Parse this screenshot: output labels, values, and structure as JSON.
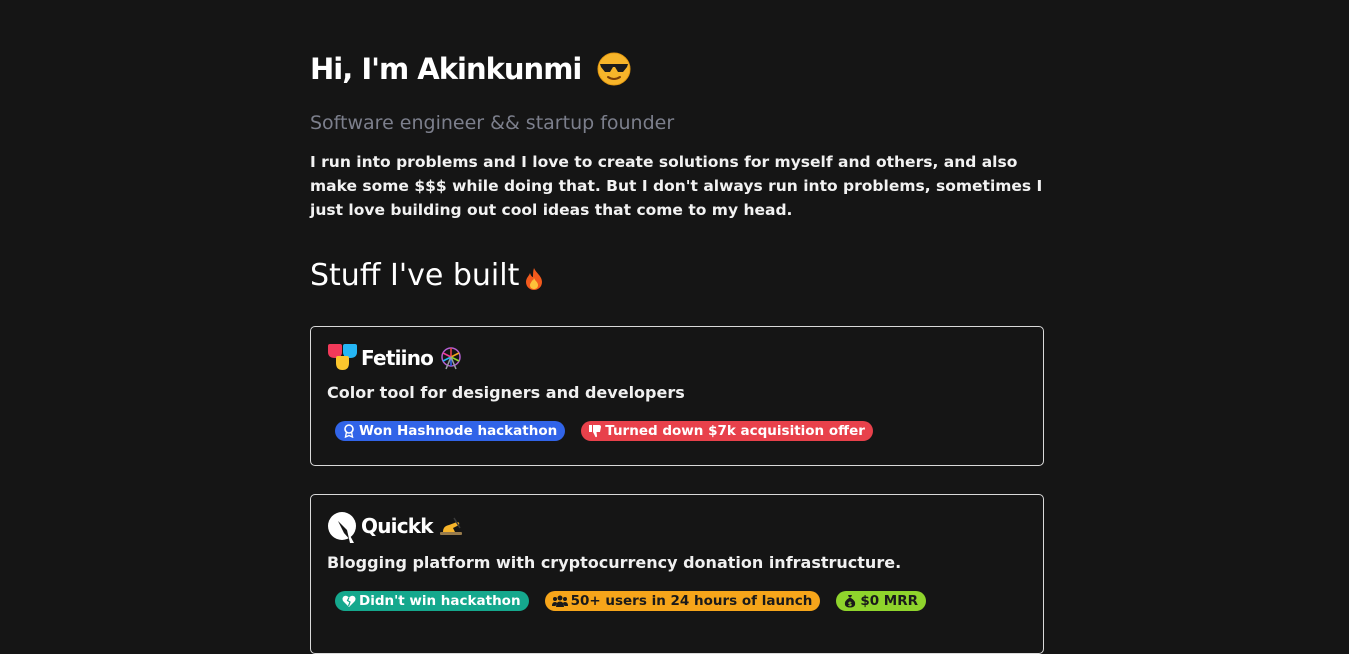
{
  "hero": {
    "greeting": "Hi, I'm Akinkunmi",
    "greeting_emoji": "smiling-face-with-sunglasses-icon",
    "subtitle": "Software engineer && startup founder",
    "bio": "I run into problems and I love to create solutions for myself and others, and also make some $$$ while doing that. But I don't always run into problems, sometimes I just love building out cool ideas that come to my head."
  },
  "projects_section": {
    "title": "Stuff I've built",
    "title_icon": "fire-icon",
    "projects": [
      {
        "name": "Fetiino",
        "logo": "fetiino-logo-icon",
        "emoji": "ferris-wheel-icon",
        "description": "Color tool for designers and developers",
        "badges": [
          {
            "icon": "award-icon",
            "label": "Won Hashnode hackathon",
            "color": "#3164e8"
          },
          {
            "icon": "thumbs-down-icon",
            "label": "Turned down $7k acquisition offer",
            "color": "#e8414b"
          }
        ]
      },
      {
        "name": "Quickk",
        "logo": "quickk-logo-icon",
        "emoji": "writing-hand-icon",
        "description": "Blogging platform with cryptocurrency donation infrastructure.",
        "badges": [
          {
            "icon": "heart-crack-icon",
            "label": "Didn't win hackathon",
            "color": "#15a88d"
          },
          {
            "icon": "users-icon",
            "label": "50+ users in 24 hours of launch",
            "color": "#f6a51a"
          },
          {
            "icon": "money-bag-icon",
            "label": "$0 MRR",
            "color": "#8fd42c"
          }
        ]
      }
    ]
  },
  "colors": {
    "background": "#151515",
    "subtitle": "#7c7f8c",
    "card_border": "#d9d9d9"
  }
}
